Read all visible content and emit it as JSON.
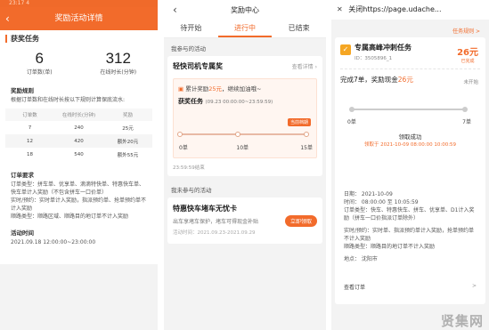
{
  "panel1": {
    "status_time": "23:17 4",
    "header_title": "奖励活动详情",
    "section_title": "获奖任务",
    "stats": [
      {
        "value": "6",
        "label": "订单数(单)"
      },
      {
        "value": "312",
        "label": "在线时长(分钟)"
      }
    ],
    "rules_title": "奖励规则",
    "rules_text": "根据订单数和在线时长按以下规则计算保底流水:",
    "table_headers": [
      "订单数",
      "在线时长(分钟)",
      "奖励"
    ],
    "table_rows": [
      [
        "7",
        "240",
        "25元"
      ],
      [
        "12",
        "420",
        "额外20元"
      ],
      [
        "18",
        "540",
        "额外55元"
      ]
    ],
    "order_req_title": "订单要求",
    "order_req_text": [
      "订单类型：拼车单、优享单、滴滴特快单、特惠快车单、快车单计入奖励（不包含拼车一口价单）",
      "实时/预约：实时单计入奖励，指派预约单、抢单预约单不计入奖励",
      "顺路类型：顺路区域、顺路目的地订单不计入奖励"
    ],
    "time_title": "活动时间",
    "time_value": "2021.09.18 12:00:00~23:00:00"
  },
  "panel2": {
    "header_title": "奖励中心",
    "tabs": [
      "待开始",
      "进行中",
      "已结束"
    ],
    "joined_label": "我参与的活动",
    "card_title": "轻快司机专属奖",
    "card_link": "查看详情",
    "accum_prefix": "累计奖励",
    "accum_amount": "25元",
    "accum_suffix": "，继续加油哦~",
    "task_name": "获奖任务",
    "task_time": "(09.23 00:00:00~23:59:59)",
    "badge": "当前档期",
    "ticks": [
      "0单",
      "10单",
      "15单"
    ],
    "ended_text": "23:59:59结束",
    "unjoined_label": "我未参与的活动",
    "card2_title": "特惠快车堵车无忧卡",
    "card2_sub": "出车享堵车保护，堵车可得现金补贴",
    "card2_time": "活动时间：2021.09.23-2021.09.29",
    "card2_button": "立即领取"
  },
  "panel3": {
    "header_title": "关闭https://page.udache...",
    "more_link": "任务规则 >",
    "card_title": "专属高峰冲刺任务",
    "card_id": "ID：3505896_1",
    "reward_amount": "26元",
    "reward_tag": "已完成",
    "done_prefix": "完成7单，奖励现金",
    "done_amount": "26元",
    "status_right": "未开始",
    "ticks": [
      "0单",
      "7单"
    ],
    "claimed": "领取成功",
    "claim_time": "领取于 2021-10-09 08:00:00 10:00:59",
    "info_lines": [
      "日期：    2021-10-09",
      "时间：    08:00:00 至 10:05:59",
      "订单类型：快车、特惠快车、拼车、优享单、D1计入奖励（拼车一口价指派订单除外）",
      "",
      "实时/预约：实时单、指派预约单计入奖励，抢单预约单不计入奖励",
      "顺路类型：顺路目的地订单不计入奖励",
      "",
      "地点：    沈阳市"
    ],
    "view_orders": "查看订单",
    "view_chev": ">"
  },
  "watermark": "贤集网"
}
